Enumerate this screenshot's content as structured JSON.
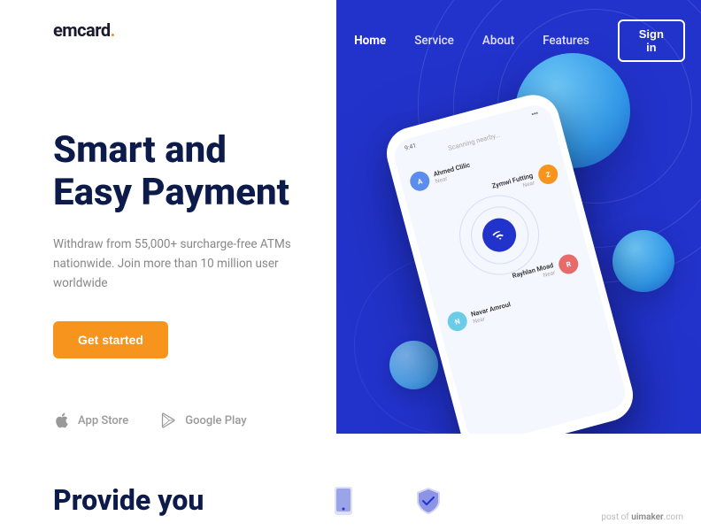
{
  "brand": {
    "logo_text": "emcard",
    "logo_dot": "."
  },
  "nav": {
    "links": [
      {
        "label": "Home",
        "active": true
      },
      {
        "label": "Service",
        "active": false
      },
      {
        "label": "About",
        "active": false
      },
      {
        "label": "Features",
        "active": false
      }
    ],
    "signin_label": "Sign in"
  },
  "hero": {
    "title_line1": "Smart and",
    "title_line2": "Easy Payment",
    "subtitle": "Withdraw from 55,000+ surcharge-free ATMs nationwide. Join more than 10 million user worldwide",
    "cta_label": "Get started"
  },
  "stores": {
    "app_store_label": "App Store",
    "google_play_label": "Google Play"
  },
  "phone": {
    "status_time": "9:41",
    "scanning_label": "Scanning nearby...",
    "contacts": [
      {
        "name": "Ahmed Clilic",
        "tag": "Near",
        "color": "#5b8cee",
        "initial": "A"
      },
      {
        "name": "Zymwi Futting",
        "tag": "Near",
        "color": "#f7941d",
        "initial": "Z"
      },
      {
        "name": "Rayhlan Moad",
        "tag": "Near",
        "color": "#e86b6b",
        "initial": "R"
      },
      {
        "name": "Navar Amroul",
        "tag": "Near",
        "color": "#6bccea",
        "initial": "N"
      }
    ]
  },
  "bottom": {
    "provide_text": "Provide you"
  },
  "uimaker": {
    "text": "post of ",
    "link": "uimaker",
    "suffix": ".com"
  }
}
